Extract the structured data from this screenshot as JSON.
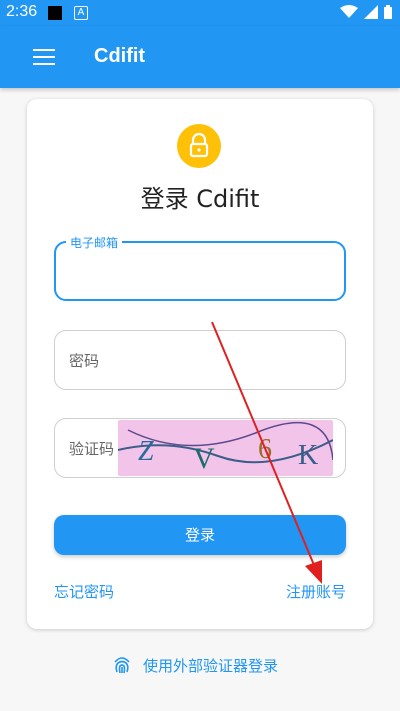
{
  "status_bar": {
    "time": "2:36",
    "icons": [
      "notification-square-icon",
      "a-badge-icon",
      "wifi-icon",
      "cellular-icon",
      "battery-icon"
    ]
  },
  "app_bar": {
    "title": "Cdifit",
    "menu_icon": "hamburger-menu-icon"
  },
  "login": {
    "lock_icon": "lock-icon",
    "title": "登录 Cdifit",
    "email_label": "电子邮箱",
    "email_value": "",
    "password_placeholder": "密码",
    "captcha_placeholder": "验证码",
    "captcha_image": "captcha-image",
    "submit_label": "登录",
    "forgot_label": "忘记密码",
    "register_label": "注册账号"
  },
  "external_login": {
    "icon": "fingerprint-icon",
    "label": "使用外部验证器登录"
  },
  "colors": {
    "primary": "#2196f3",
    "lock_bg": "#ffc107",
    "annotation_arrow": "#e02020"
  }
}
